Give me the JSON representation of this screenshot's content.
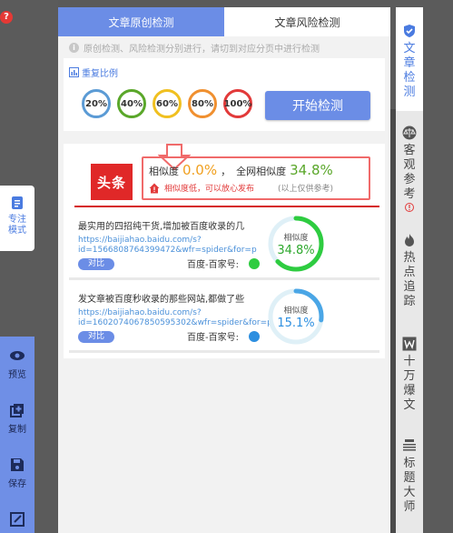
{
  "help": {
    "glyph": "?"
  },
  "focus_mode": {
    "label": "专注模式"
  },
  "left_tools": [
    {
      "label": "预览",
      "icon": "eye-icon"
    },
    {
      "label": "复制",
      "icon": "copy-icon"
    },
    {
      "label": "保存",
      "icon": "save-icon"
    },
    {
      "label": "",
      "icon": "edit-icon"
    }
  ],
  "tabs": [
    {
      "label": "文章原创检测",
      "active": true
    },
    {
      "label": "文章风险检测",
      "active": false
    }
  ],
  "notice": "原创检测、风险检测分别进行，请切到对应分页中进行检测",
  "ratio": {
    "title": "重复比例",
    "options": [
      {
        "label": "20%",
        "color": "#5b9bd5"
      },
      {
        "label": "40%",
        "color": "#5aa72a"
      },
      {
        "label": "60%",
        "color": "#f0c020"
      },
      {
        "label": "80%",
        "color": "#f09030"
      },
      {
        "label": "100%",
        "color": "#e23a3a"
      }
    ]
  },
  "start_button": "开始检测",
  "summary": {
    "logo": "头条",
    "similarity_label": "相似度",
    "similarity_value": "0.0%",
    "separator": "，",
    "web_label": "全网相似度",
    "web_value": "34.8%",
    "warning": "相似度低，可以放心发布",
    "reference": "(以上仅供参考)"
  },
  "results": [
    {
      "title": "最实用的四招纯干货,增加被百度收录的几",
      "url_line1": "https://baijiahao.baidu.com/s?",
      "url_line2": "id=1566808764399472&wfr=spider&for=p",
      "compare": "对比",
      "source": "百度-百家号:",
      "dot_color": "#2ecc40",
      "gauge_label": "相似度",
      "gauge_value": "34.8%",
      "gauge_percent": 34.8,
      "gauge_color": "#2ecc40",
      "value_color": "#2ea82e"
    },
    {
      "title": "发文章被百度秒收录的那些网站,都做了些",
      "url_line1": "https://baijiahao.baidu.com/s?",
      "url_line2": "id=1602074067850595302&wfr=spider&for=pc",
      "compare": "对比",
      "source": "百度-百家号:",
      "dot_color": "#2d8fe0",
      "gauge_label": "相似度",
      "gauge_value": "15.1%",
      "gauge_percent": 15.1,
      "gauge_color": "#4aa6e6",
      "value_color": "#2d8fe0"
    }
  ],
  "right_tabs": [
    {
      "label": "文章检测",
      "icon": "shield-icon",
      "active": true
    },
    {
      "label": "客观参考",
      "icon": "scale-icon",
      "active": false
    },
    {
      "label": "热点追踪",
      "icon": "hot-flame-icon",
      "active": false
    },
    {
      "label": "十万爆文",
      "icon": "w-badge-icon",
      "active": false
    },
    {
      "label": "标题大师",
      "icon": "title-icon",
      "active": false
    }
  ],
  "colors": {
    "accent": "#6b8de6",
    "danger": "#e23a3a"
  }
}
